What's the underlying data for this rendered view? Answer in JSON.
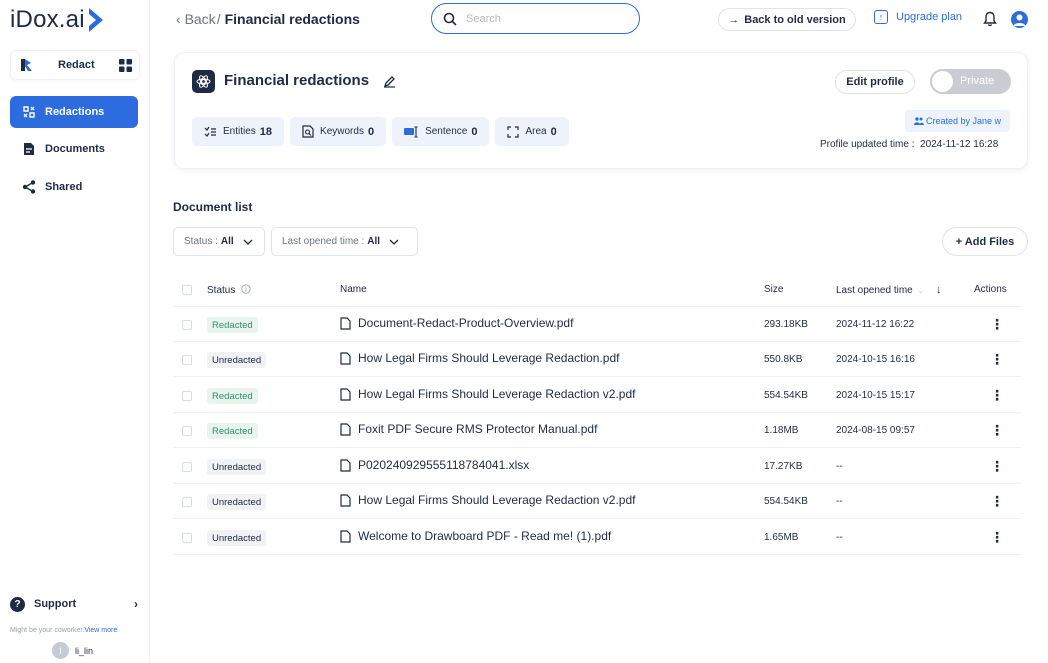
{
  "brand": {
    "logo_text": "iDox.ai",
    "app_name": "Redact"
  },
  "sidebar": {
    "items": [
      {
        "label": "Redactions",
        "icon": "redactions-icon",
        "active": true
      },
      {
        "label": "Documents",
        "icon": "documents-icon",
        "active": false
      },
      {
        "label": "Shared",
        "icon": "share-icon",
        "active": false
      }
    ],
    "support_label": "Support",
    "coworker_text": "Might be your coworker.",
    "coworker_link": "View more",
    "user_initial": "l",
    "user_name": "li_lin"
  },
  "topbar": {
    "back_label": "Back",
    "separator": "/",
    "current": "Financial redactions",
    "search_placeholder": "Search",
    "back_old_label": "Back to old version",
    "upgrade_label": "Upgrade plan"
  },
  "profile": {
    "title": "Financial redactions",
    "edit_label": "Edit profile",
    "privacy_label": "Private",
    "chips": [
      {
        "label": "Entities",
        "count": "18"
      },
      {
        "label": "Keywords",
        "count": "0"
      },
      {
        "label": "Sentence",
        "count": "0"
      },
      {
        "label": "Area",
        "count": "0"
      }
    ],
    "created_by": "Created by Jane w",
    "updated_label": "Profile updated time :",
    "updated_value": "2024-11-12 16:28"
  },
  "doclist": {
    "title": "Document list",
    "filter_status_label": "Status :",
    "filter_status_value": "All",
    "filter_opened_label": "Last opened time :",
    "filter_opened_value": "All",
    "add_files_label": "+ Add Files",
    "columns": {
      "status": "Status",
      "name": "Name",
      "size": "Size",
      "last_opened": "Last opened time",
      "actions": "Actions"
    },
    "rows": [
      {
        "status": "Redacted",
        "name": "Document-Redact-Product-Overview.pdf",
        "size": "293.18KB",
        "opened": "2024-11-12 16:22"
      },
      {
        "status": "Unredacted",
        "name": "How Legal Firms Should Leverage Redaction.pdf",
        "size": "550.8KB",
        "opened": "2024-10-15 16:16"
      },
      {
        "status": "Redacted",
        "name": "How Legal Firms Should Leverage Redaction v2.pdf",
        "size": "554.54KB",
        "opened": "2024-10-15 15:17"
      },
      {
        "status": "Redacted",
        "name": "Foxit PDF Secure RMS Protector Manual.pdf",
        "size": "1.18MB",
        "opened": "2024-08-15 09:57"
      },
      {
        "status": "Unredacted",
        "name": "P020240929555118784041.xlsx",
        "size": "17.27KB",
        "opened": "--"
      },
      {
        "status": "Unredacted",
        "name": "How Legal Firms Should Leverage Redaction v2.pdf",
        "size": "554.54KB",
        "opened": "--"
      },
      {
        "status": "Unredacted",
        "name": "Welcome to Drawboard PDF - Read me! (1).pdf",
        "size": "1.65MB",
        "opened": "--"
      }
    ]
  },
  "colors": {
    "accent": "#2d6cdf",
    "text": "#1f2a44",
    "redacted_bg": "#e7f5ee",
    "redacted_fg": "#3a8f63"
  }
}
